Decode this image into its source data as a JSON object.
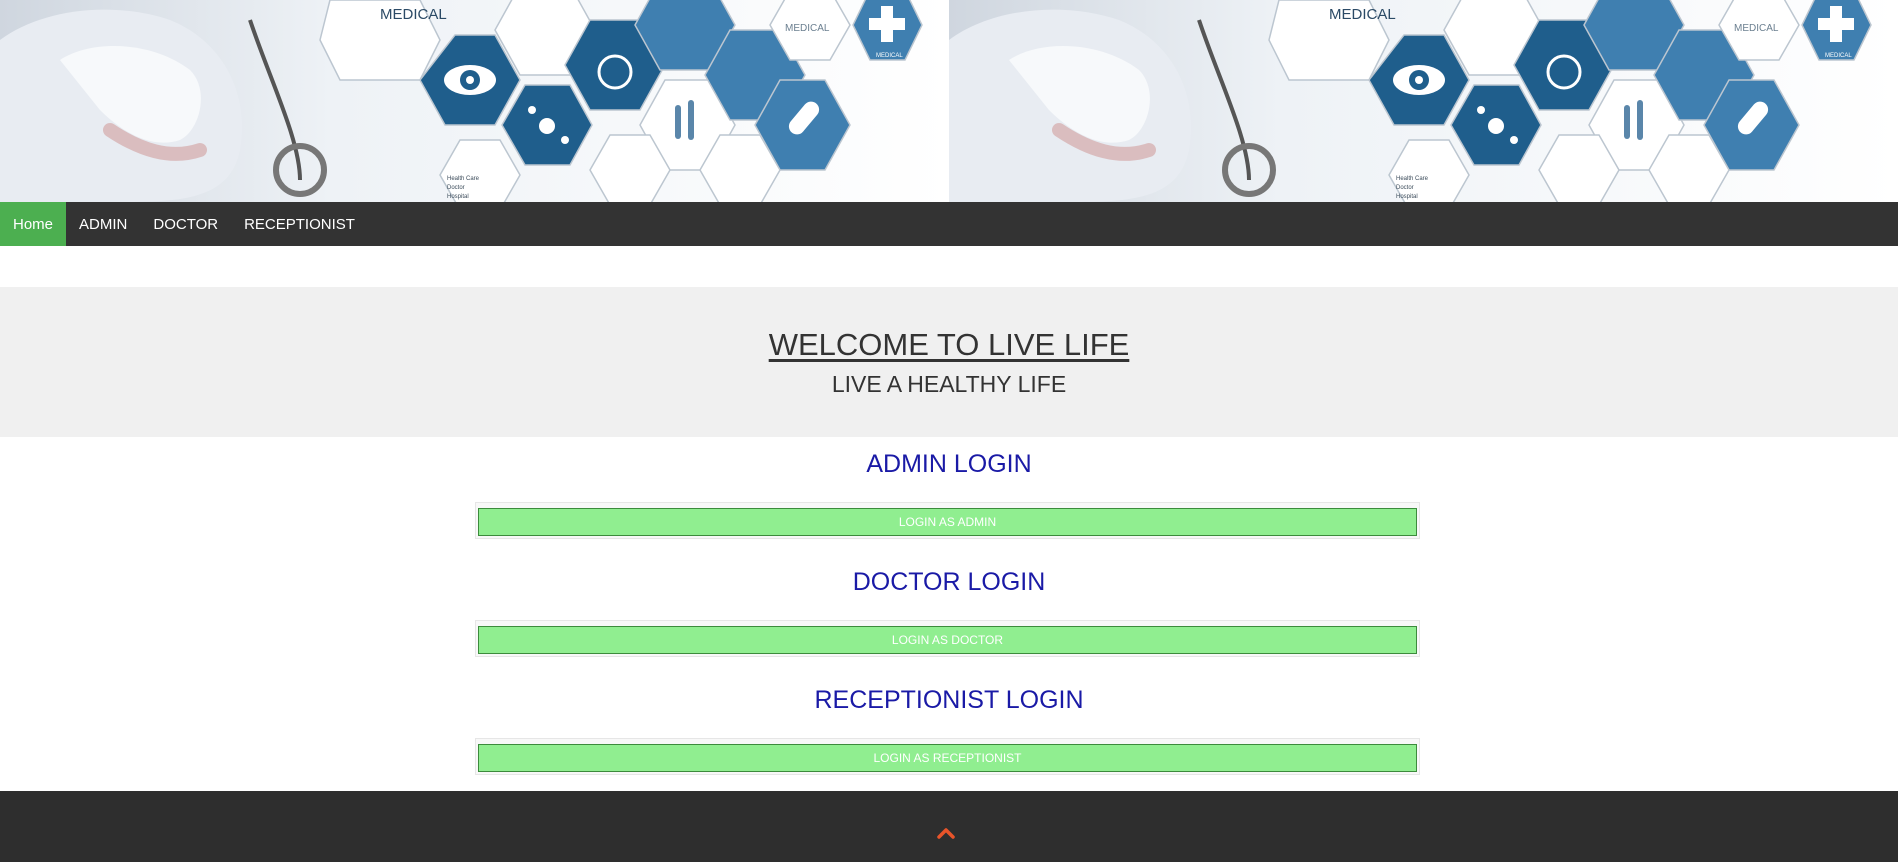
{
  "banner": {
    "tile_text": {
      "medical_large": "MEDICAL",
      "medical_small": "MEDICAL",
      "cross_label": "MEDICAL",
      "list": [
        "Health Care",
        "Doctor",
        "Hospital"
      ]
    },
    "colors": {
      "hex_dark": "#1f5e8c",
      "hex_mid": "#3f7fb0",
      "hex_light": "#ffffff",
      "background": "#e9eef4"
    }
  },
  "nav": {
    "items": [
      "Home",
      "ADMIN",
      "DOCTOR",
      "RECEPTIONIST"
    ],
    "active_index": 0,
    "colors": {
      "bar": "#333333",
      "active": "#4caf50"
    }
  },
  "welcome": {
    "title": "WELCOME TO LIVE LIFE",
    "subtitle": "LIVE A HEALTHY LIFE"
  },
  "sections": [
    {
      "title": "ADMIN LOGIN",
      "button": "LOGIN AS ADMIN"
    },
    {
      "title": "DOCTOR LOGIN",
      "button": "LOGIN AS DOCTOR"
    },
    {
      "title": "RECEPTIONIST LOGIN",
      "button": "LOGIN AS RECEPTIONIST"
    }
  ],
  "colors": {
    "section_title": "#1a1aa6",
    "button_bg": "#90ee90",
    "footer": "#2e2e2e",
    "scroll_top_icon": "#e8542a"
  },
  "footer": {
    "icon": "chevron-up-icon"
  }
}
